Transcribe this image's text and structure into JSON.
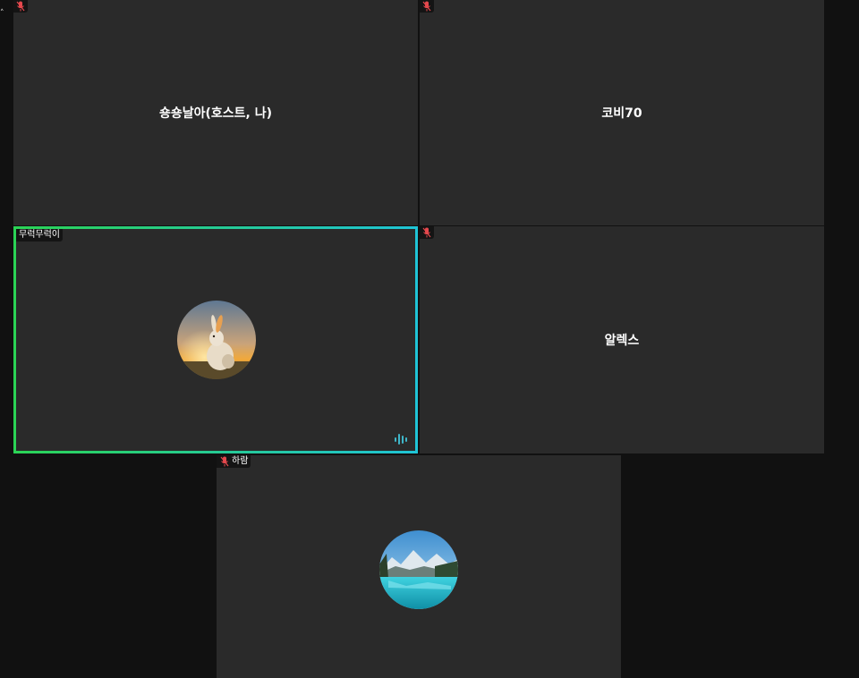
{
  "participants": [
    {
      "id": "p1",
      "name": "숑숑날아(호스트, 나)",
      "muted": true,
      "show_name_tag": false
    },
    {
      "id": "p2",
      "name": "코비70",
      "muted": true,
      "show_name_tag": false
    },
    {
      "id": "p3",
      "name": "무럭무럭이",
      "tag_label": "무럭무럭이",
      "muted": false,
      "speaking": true,
      "avatar": "rabbit-photo"
    },
    {
      "id": "p4",
      "name": "알렉스",
      "muted": true,
      "show_name_tag": false
    },
    {
      "id": "p5",
      "name": "하람",
      "tag_label": "하람",
      "muted": true,
      "avatar": "lake-mountain-photo"
    }
  ],
  "colors": {
    "background": "#111111",
    "tile": "#2a2a2a",
    "speaking_border_start": "#2bd455",
    "speaking_border_end": "#1fc4d6",
    "mic_off": "#e5484d",
    "audio_level": "#3fb6c9"
  },
  "icons": {
    "mic_off": "mic-off-icon",
    "audio_level": "audio-level-icon",
    "caret": "chevron-up-icon"
  }
}
